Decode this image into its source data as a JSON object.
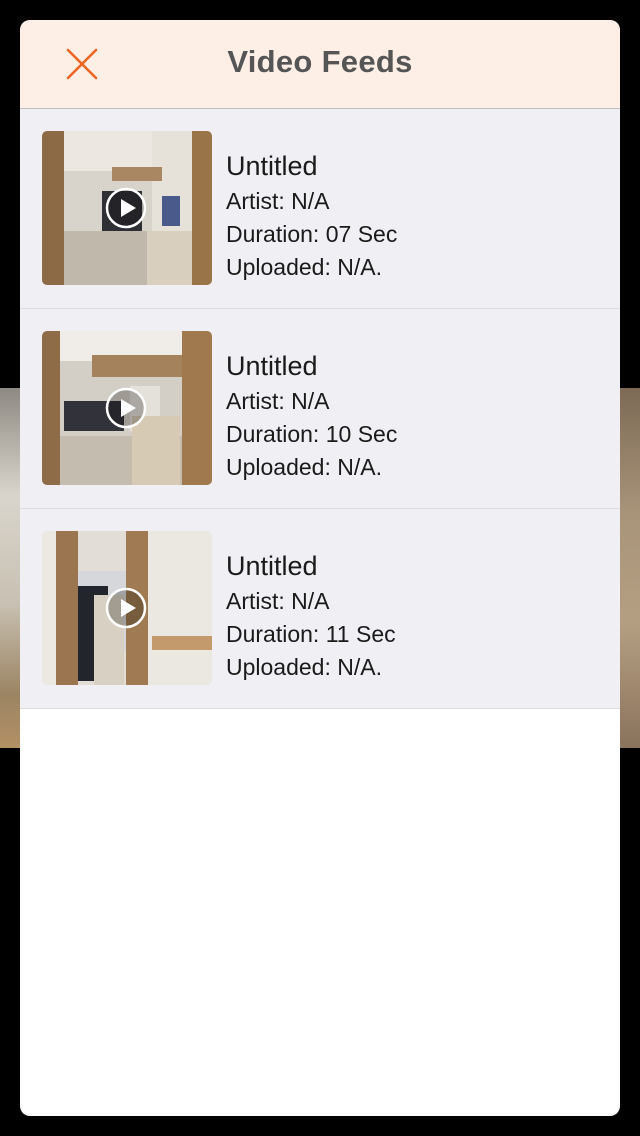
{
  "header": {
    "title": "Video Feeds",
    "close_icon": "close-icon",
    "accent_color": "#f26522",
    "background_color": "#fdeee6"
  },
  "feeds": [
    {
      "title": "Untitled",
      "artist": "Artist: N/A",
      "duration": "Duration: 07 Sec",
      "uploaded": "Uploaded: N/A.",
      "thumbnail_icon": "video-thumbnail",
      "play_icon": "play-icon"
    },
    {
      "title": "Untitled",
      "artist": "Artist: N/A",
      "duration": "Duration: 10 Sec",
      "uploaded": "Uploaded: N/A.",
      "thumbnail_icon": "video-thumbnail",
      "play_icon": "play-icon"
    },
    {
      "title": "Untitled",
      "artist": "Artist: N/A",
      "duration": "Duration: 11 Sec",
      "uploaded": "Uploaded: N/A.",
      "thumbnail_icon": "video-thumbnail",
      "play_icon": "play-icon"
    }
  ]
}
